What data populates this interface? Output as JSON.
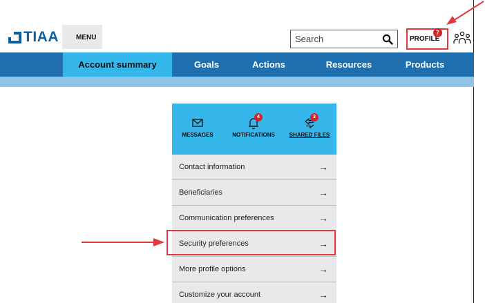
{
  "header": {
    "logo_text": "TIAA",
    "menu_label": "MENU",
    "search": {
      "placeholder": "Search",
      "value": ""
    },
    "profile_label": "PROFILE",
    "profile_badge": "7"
  },
  "nav": {
    "items": [
      {
        "label": "Account summary",
        "active": true
      },
      {
        "label": "Goals"
      },
      {
        "label": "Actions"
      },
      {
        "label": "Resources"
      },
      {
        "label": "Products"
      }
    ]
  },
  "profile_menu": {
    "tiles": [
      {
        "label": "MESSAGES",
        "icon": "envelope-icon"
      },
      {
        "label": "NOTIFICATIONS",
        "icon": "bell-icon",
        "badge": "4"
      },
      {
        "label": "SHARED FILES",
        "icon": "transfer-arrows-icon",
        "badge": "3"
      }
    ],
    "items": [
      {
        "label": "Contact information"
      },
      {
        "label": "Beneficiaries"
      },
      {
        "label": "Communication preferences"
      },
      {
        "label": "Security preferences",
        "highlighted": true
      },
      {
        "label": "More profile options"
      },
      {
        "label": "Customize your account"
      }
    ],
    "arrow_glyph": "→"
  },
  "colors": {
    "brand_blue": "#0d5fa3",
    "nav_blue": "#1f6fae",
    "accent_cyan": "#35b7eb",
    "highlight_red": "#e03a3e",
    "badge_red": "#d3252b"
  }
}
